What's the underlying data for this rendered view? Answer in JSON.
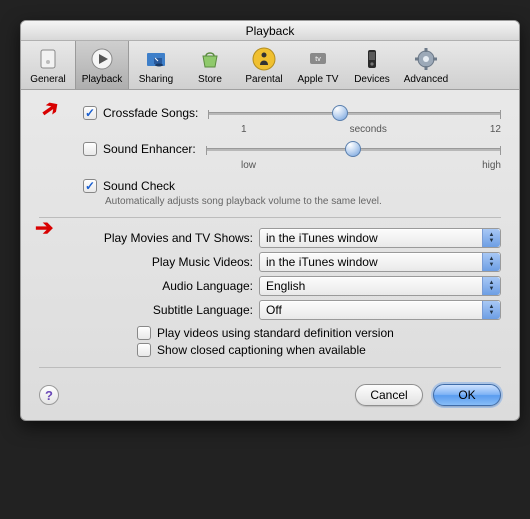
{
  "title": "Playback",
  "tabs": [
    {
      "label": "General"
    },
    {
      "label": "Playback"
    },
    {
      "label": "Sharing"
    },
    {
      "label": "Store"
    },
    {
      "label": "Parental"
    },
    {
      "label": "Apple TV"
    },
    {
      "label": "Devices"
    },
    {
      "label": "Advanced"
    }
  ],
  "crossfade": {
    "label": "Crossfade Songs:",
    "min": "1",
    "unit": "seconds",
    "max": "12"
  },
  "enhancer": {
    "label": "Sound Enhancer:",
    "low": "low",
    "high": "high"
  },
  "soundcheck": {
    "label": "Sound Check",
    "desc": "Automatically adjusts song playback volume to the same level."
  },
  "form": {
    "movies": {
      "label": "Play Movies and TV Shows:",
      "value": "in the iTunes window"
    },
    "music": {
      "label": "Play Music Videos:",
      "value": "in the iTunes window"
    },
    "audio": {
      "label": "Audio Language:",
      "value": "English"
    },
    "subtitle": {
      "label": "Subtitle Language:",
      "value": "Off"
    }
  },
  "subopts": {
    "sd": "Play videos using standard definition version",
    "cc": "Show closed captioning when available"
  },
  "buttons": {
    "cancel": "Cancel",
    "ok": "OK",
    "help": "?"
  }
}
